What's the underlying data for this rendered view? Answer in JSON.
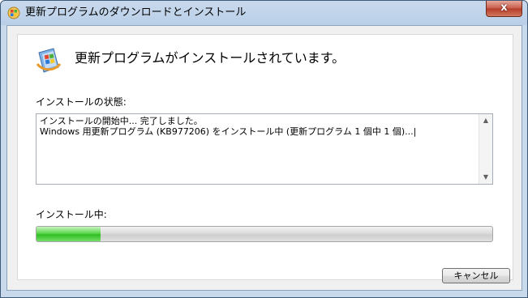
{
  "window": {
    "title": "更新プログラムのダウンロードとインストール",
    "close_label": "x"
  },
  "main": {
    "heading": "更新プログラムがインストールされています。",
    "status_label": "インストールの状態:",
    "log_lines": [
      "インストールの開始中... 完了しました。",
      "Windows 用更新プログラム (KB977206) をインストール中 (更新プログラム 1 個中 1 個)...|"
    ],
    "progress_label": "インストール中:",
    "progress_fraction": 0.14
  },
  "footer": {
    "cancel_label": "キャンセル"
  },
  "icons": {
    "title": "windows-update-icon",
    "heading": "windows-update-shield-icon"
  },
  "colors": {
    "progress_fill": "#3fc52f",
    "titlebar": "#b9cfe8",
    "close_button": "#c75b48"
  }
}
